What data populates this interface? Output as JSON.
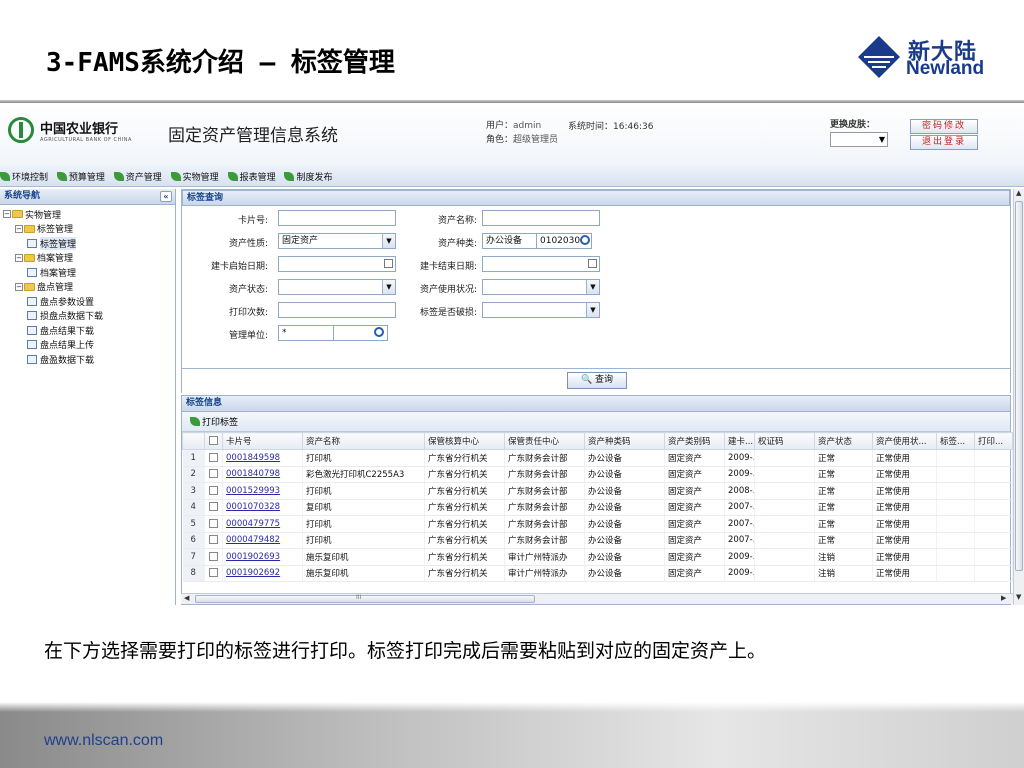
{
  "slide": {
    "title": "3-FAMS系统介绍 – 标签管理",
    "logo_cn": "新大陆",
    "logo_en": "Newland",
    "caption": "在下方选择需要打印的标签进行打印。标签打印完成后需要粘贴到对应的固定资产上。",
    "footer_url": "www.nlscan.com"
  },
  "app": {
    "bank_name": "中国农业银行",
    "bank_sub": "AGRICULTURAL BANK OF CHINA",
    "system_title": "固定资产管理信息系统",
    "user_label": "用户：",
    "user_value": "admin",
    "role_label": "角色：",
    "role_value": "超级管理员",
    "time_label": "系统时间：",
    "time_value": "16:46:36",
    "skin_label": "更换皮肤：",
    "btn_password": "密码修改",
    "btn_logout": "退出登录",
    "menu": [
      "环境控制",
      "预算管理",
      "资产管理",
      "实物管理",
      "报表管理",
      "制度发布"
    ],
    "nav_title": "系统导航",
    "nav_collapse": "«",
    "tree": [
      {
        "label": "实物管理",
        "level": 0,
        "type": "folder",
        "toggle": "−"
      },
      {
        "label": "标签管理",
        "level": 1,
        "type": "folder",
        "toggle": "−"
      },
      {
        "label": "标签管理",
        "level": 2,
        "type": "page",
        "selected": true
      },
      {
        "label": "档案管理",
        "level": 1,
        "type": "folder",
        "toggle": "−"
      },
      {
        "label": "档案管理",
        "level": 2,
        "type": "page"
      },
      {
        "label": "盘点管理",
        "level": 1,
        "type": "folder",
        "toggle": "−"
      },
      {
        "label": "盘点参数设置",
        "level": 2,
        "type": "page"
      },
      {
        "label": "损盘点数据下载",
        "level": 2,
        "type": "page"
      },
      {
        "label": "盘点结果下载",
        "level": 2,
        "type": "page"
      },
      {
        "label": "盘点结果上传",
        "level": 2,
        "type": "page"
      },
      {
        "label": "盘盈数据下载",
        "level": 2,
        "type": "page"
      }
    ],
    "query": {
      "title": "标签查询",
      "card_no_label": "卡片号:",
      "asset_name_label": "资产名称:",
      "asset_nature_label": "资产性质:",
      "asset_nature_value": "固定资产",
      "asset_type_label": "资产种类:",
      "asset_type_value": "办公设备",
      "asset_type_code": "0102030",
      "start_date_label": "建卡启始日期:",
      "end_date_label": "建卡结束日期:",
      "asset_status_label": "资产状态:",
      "asset_usage_label": "资产使用状况:",
      "print_count_label": "打印次数:",
      "damaged_label": "标签是否破损:",
      "unit_label": "管理单位:",
      "unit_value": "*",
      "query_button": "查询"
    },
    "info": {
      "title": "标签信息",
      "print_button": "打印标签",
      "columns": [
        "卡片号",
        "资产名称",
        "保管核算中心",
        "保管责任中心",
        "资产种类码",
        "资产类别码",
        "建卡...",
        "权证码",
        "资产状态",
        "资产使用状...",
        "标签...",
        "打印..."
      ],
      "rows": [
        [
          "0001849598",
          "打印机",
          "广东省分行机关",
          "广东财务会计部",
          "办公设备",
          "固定资产",
          "2009-...",
          "",
          "正常",
          "正常使用",
          "",
          ""
        ],
        [
          "0001840798",
          "彩色激光打印机C2255A3",
          "广东省分行机关",
          "广东财务会计部",
          "办公设备",
          "固定资产",
          "2009-...",
          "",
          "正常",
          "正常使用",
          "",
          ""
        ],
        [
          "0001529993",
          "打印机",
          "广东省分行机关",
          "广东财务会计部",
          "办公设备",
          "固定资产",
          "2008-...",
          "",
          "正常",
          "正常使用",
          "",
          ""
        ],
        [
          "0001070328",
          "复印机",
          "广东省分行机关",
          "广东财务会计部",
          "办公设备",
          "固定资产",
          "2007-...",
          "",
          "正常",
          "正常使用",
          "",
          ""
        ],
        [
          "0000479775",
          "打印机",
          "广东省分行机关",
          "广东财务会计部",
          "办公设备",
          "固定资产",
          "2007-...",
          "",
          "正常",
          "正常使用",
          "",
          ""
        ],
        [
          "0000479482",
          "打印机",
          "广东省分行机关",
          "广东财务会计部",
          "办公设备",
          "固定资产",
          "2007-...",
          "",
          "正常",
          "正常使用",
          "",
          ""
        ],
        [
          "0001902693",
          "施乐复印机",
          "广东省分行机关",
          "审计广州特派办",
          "办公设备",
          "固定资产",
          "2009-...",
          "",
          "注销",
          "正常使用",
          "",
          ""
        ],
        [
          "0001902692",
          "施乐复印机",
          "广东省分行机关",
          "审计广州特派办",
          "办公设备",
          "固定资产",
          "2009-...",
          "",
          "注销",
          "正常使用",
          "",
          ""
        ]
      ]
    },
    "scroll_marker": "III"
  },
  "colors": {
    "accent": "#15428b",
    "brand": "#1a3a8a",
    "leaf": "#3d9a3a"
  }
}
